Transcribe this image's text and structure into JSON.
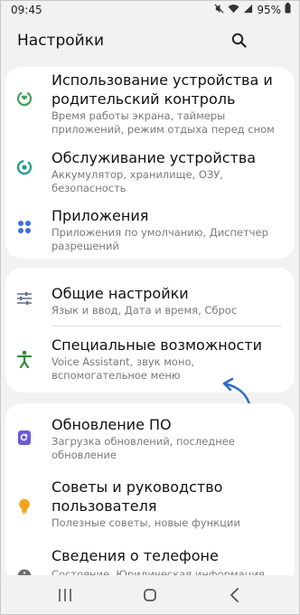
{
  "status_bar": {
    "time": "09:45",
    "battery": "95%",
    "icons": [
      "mute-icon",
      "wifi-icon",
      "signal-icon",
      "battery-icon"
    ]
  },
  "header": {
    "title": "Настройки",
    "search_icon": "search-icon"
  },
  "cards": [
    {
      "items": [
        {
          "title": "Использование устройства и родительский контроль",
          "subtitle": "Время работы экрана, таймеры приложений, режим отдыха перед сном",
          "icon": "digital-wellbeing-icon",
          "icon_color": "#3aa35a"
        },
        {
          "title": "Обслуживание устройства",
          "subtitle": "Аккумулятор, хранилище, ОЗУ, безопасность",
          "icon": "device-care-icon",
          "icon_color": "#1e9a8a"
        },
        {
          "title": "Приложения",
          "subtitle": "Приложения по умолчанию, Диспетчер разрешений",
          "icon": "apps-icon",
          "icon_color": "#3f6fd8"
        }
      ]
    },
    {
      "items": [
        {
          "title": "Общие настройки",
          "subtitle": "Язык и ввод, Дата и время, Сброс",
          "icon": "sliders-icon",
          "icon_color": "#5a6e8c"
        },
        {
          "title": "Специальные возможности",
          "subtitle": "Voice Assistant, звук моно, вспомогательное меню",
          "icon": "accessibility-icon",
          "icon_color": "#2f8a3a"
        }
      ]
    },
    {
      "items": [
        {
          "title": "Обновление ПО",
          "subtitle": "Загрузка обновлений, последнее обновление",
          "icon": "software-update-icon",
          "icon_color": "#6a5bd8"
        },
        {
          "title": "Советы и руководство пользователя",
          "subtitle": "Полезные советы, новые функции",
          "icon": "lightbulb-icon",
          "icon_color": "#f2a31b"
        },
        {
          "title": "Сведения о телефоне",
          "subtitle": "Состояние, Юридическая информация, Имя",
          "icon": "info-icon",
          "icon_color": "#6e6e6e"
        }
      ]
    }
  ],
  "annotation": {
    "arrow_color": "#2f6fc7"
  },
  "nav_bar": {
    "recents": "recents-icon",
    "home": "home-icon",
    "back": "back-icon"
  }
}
